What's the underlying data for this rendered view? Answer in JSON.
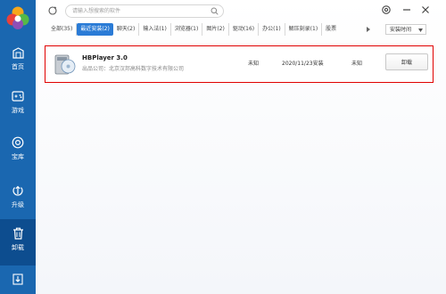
{
  "colors": {
    "sidebar": "#1a67b0",
    "active": "#0d4d8f",
    "accent": "#2a7bd6",
    "highlight": "#e00000"
  },
  "sidebar": {
    "items": [
      {
        "label": "首页",
        "icon": "home-icon"
      },
      {
        "label": "游戏",
        "icon": "gamepad-icon"
      },
      {
        "label": "宝库",
        "icon": "treasure-icon"
      },
      {
        "label": "升级",
        "icon": "upgrade-icon"
      },
      {
        "label": "卸载",
        "icon": "trash-icon",
        "active": true
      }
    ],
    "bottom_icon": "download-icon"
  },
  "search": {
    "placeholder": "请输入想搜索的软件"
  },
  "tabs": [
    {
      "label": "全部(35)"
    },
    {
      "label": "最近安装(2)",
      "active": true
    },
    {
      "label": "聊天(2)"
    },
    {
      "label": "输入法(1)"
    },
    {
      "label": "浏览器(1)"
    },
    {
      "label": "图片(2)"
    },
    {
      "label": "驱动(16)"
    },
    {
      "label": "办公(1)"
    },
    {
      "label": "解压刻录(1)"
    },
    {
      "label": "股票"
    }
  ],
  "sort": {
    "label": "安装时间"
  },
  "apps": [
    {
      "name": "HBPlayer 3.0",
      "publisher": "出品公司：北京汉邦高科数字技术有限公司",
      "size": "未知",
      "date": "2020/11/23安装",
      "frequency": "未知",
      "action": "卸载"
    }
  ]
}
